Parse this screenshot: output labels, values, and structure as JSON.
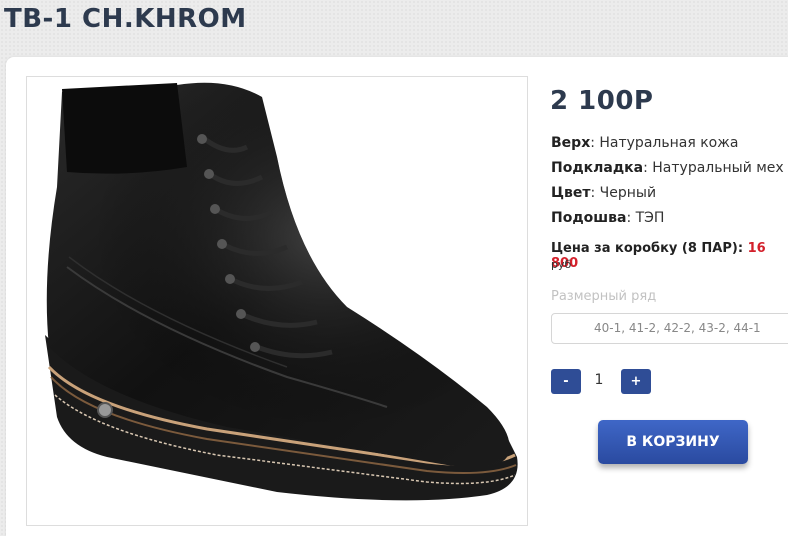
{
  "product": {
    "title": "TB-1 CH.KHROM",
    "price": "2 100Р",
    "image_alt": "boot-photo"
  },
  "specs": [
    {
      "label": "Верх",
      "value": ": Натуральная кожа"
    },
    {
      "label": "Подкладка",
      "value": ": Натуральный мех"
    },
    {
      "label": "Цвет",
      "value": ": Черный"
    },
    {
      "label": "Подошва",
      "value": ": ТЭП"
    }
  ],
  "box_price": {
    "label": "Цена за коробку (8 ПАР): ",
    "value": "16 800",
    "currency": "руб"
  },
  "size": {
    "label": "Размерный ряд",
    "selected": "40-1, 41-2, 42-2, 43-2, 44-1"
  },
  "quantity": {
    "minus": "-",
    "value": "1",
    "plus": "+"
  },
  "cart_button": "В КОРЗИНУ",
  "colors": {
    "title": "#2d3a4e",
    "accent_button": "#2f4d96",
    "box_price_value": "#d3202b"
  }
}
